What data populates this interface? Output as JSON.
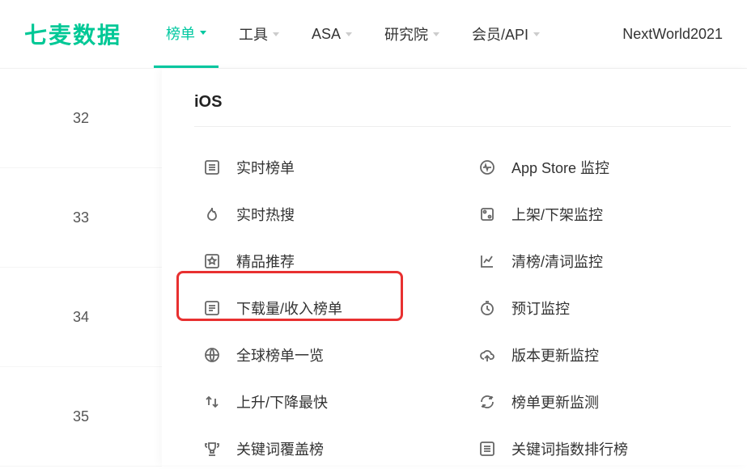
{
  "logo": "七麦数据",
  "nav": [
    {
      "label": "榜单",
      "active": true
    },
    {
      "label": "工具",
      "active": false
    },
    {
      "label": "ASA",
      "active": false
    },
    {
      "label": "研究院",
      "active": false
    },
    {
      "label": "会员/API",
      "active": false
    }
  ],
  "user": "NextWorld2021",
  "sideNumbers": [
    "32",
    "33",
    "34",
    "35"
  ],
  "dropdown": {
    "title": "iOS",
    "col1": [
      {
        "icon": "list",
        "label": "实时榜单"
      },
      {
        "icon": "fire",
        "label": "实时热搜"
      },
      {
        "icon": "star",
        "label": "精品推荐"
      },
      {
        "icon": "list2",
        "label": "下载量/收入榜单"
      },
      {
        "icon": "globe",
        "label": "全球榜单一览"
      },
      {
        "icon": "updown",
        "label": "上升/下降最快"
      },
      {
        "icon": "trophy",
        "label": "关键词覆盖榜"
      }
    ],
    "col2": [
      {
        "icon": "pulse",
        "label": "App Store 监控"
      },
      {
        "icon": "box",
        "label": "上架/下架监控"
      },
      {
        "icon": "chart",
        "label": "清榜/清词监控"
      },
      {
        "icon": "timer",
        "label": "预订监控"
      },
      {
        "icon": "cloud",
        "label": "版本更新监控"
      },
      {
        "icon": "refresh",
        "label": "榜单更新监测"
      },
      {
        "icon": "list3",
        "label": "关键词指数排行榜"
      }
    ]
  }
}
